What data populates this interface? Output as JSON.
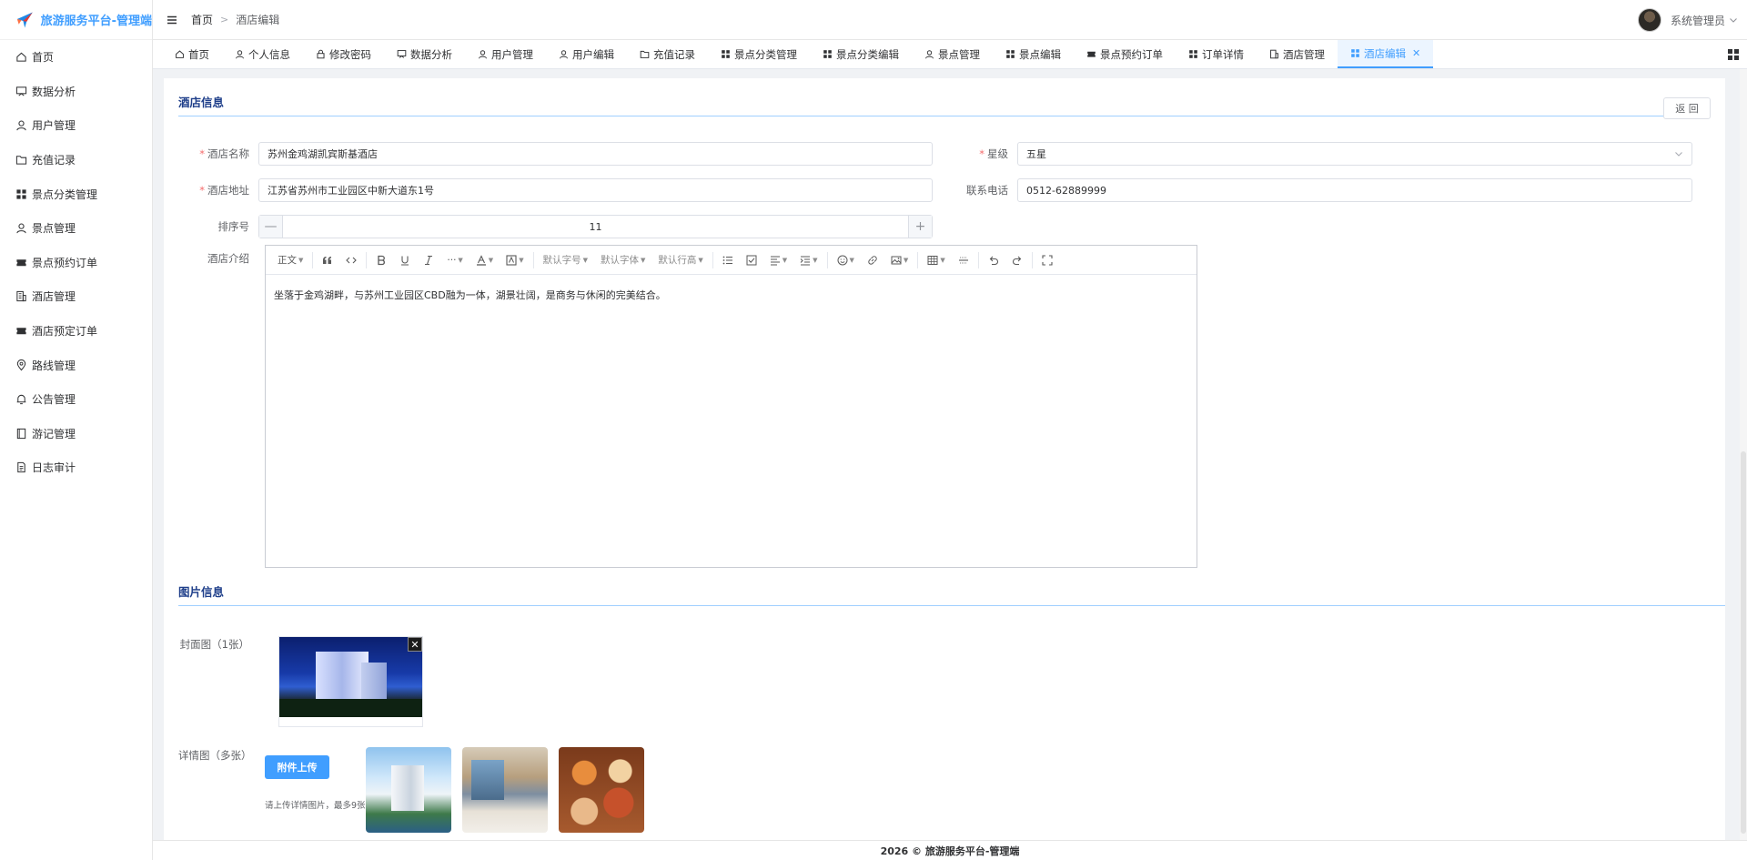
{
  "app": {
    "title": "旅游服务平台-管理端"
  },
  "sidebar": {
    "items": [
      {
        "label": "首页",
        "icon": "home-icon"
      },
      {
        "label": "数据分析",
        "icon": "chart-board-icon"
      },
      {
        "label": "用户管理",
        "icon": "user-icon"
      },
      {
        "label": "充值记录",
        "icon": "folder-icon"
      },
      {
        "label": "景点分类管理",
        "icon": "grid-icon"
      },
      {
        "label": "景点管理",
        "icon": "user-icon"
      },
      {
        "label": "景点预约订单",
        "icon": "ticket-icon"
      },
      {
        "label": "酒店管理",
        "icon": "building-icon"
      },
      {
        "label": "酒店预定订单",
        "icon": "ticket-icon"
      },
      {
        "label": "路线管理",
        "icon": "location-icon"
      },
      {
        "label": "公告管理",
        "icon": "bell-icon"
      },
      {
        "label": "游记管理",
        "icon": "notebook-icon"
      },
      {
        "label": "日志审计",
        "icon": "document-icon"
      }
    ]
  },
  "header": {
    "breadcrumb": [
      "首页",
      "酒店编辑"
    ],
    "user_name": "系统管理员"
  },
  "tabs": [
    {
      "label": "首页",
      "icon": "home-icon"
    },
    {
      "label": "个人信息",
      "icon": "user-icon"
    },
    {
      "label": "修改密码",
      "icon": "lock-icon"
    },
    {
      "label": "数据分析",
      "icon": "chart-board-icon"
    },
    {
      "label": "用户管理",
      "icon": "user-icon"
    },
    {
      "label": "用户编辑",
      "icon": "user-icon"
    },
    {
      "label": "充值记录",
      "icon": "folder-icon"
    },
    {
      "label": "景点分类管理",
      "icon": "grid-icon"
    },
    {
      "label": "景点分类编辑",
      "icon": "grid-icon"
    },
    {
      "label": "景点管理",
      "icon": "user-icon"
    },
    {
      "label": "景点编辑",
      "icon": "grid-icon"
    },
    {
      "label": "景点预约订单",
      "icon": "ticket-icon"
    },
    {
      "label": "订单详情",
      "icon": "grid-icon"
    },
    {
      "label": "酒店管理",
      "icon": "building-icon"
    },
    {
      "label": "酒店编辑",
      "icon": "grid-icon",
      "active": true
    }
  ],
  "hotel_section": {
    "title": "酒店信息",
    "back_label": "返 回",
    "name_label": "酒店名称",
    "name_value": "苏州金鸡湖凯宾斯基酒店",
    "star_label": "星级",
    "star_value": "五星",
    "address_label": "酒店地址",
    "address_value": "江苏省苏州市工业园区中新大道东1号",
    "phone_label": "联系电话",
    "phone_value": "0512-62889999",
    "sort_label": "排序号",
    "sort_value": "11",
    "intro_label": "酒店介绍",
    "intro_text": "坐落于金鸡湖畔，与苏州工业园区CBD融为一体，湖景壮阔，是商务与休闲的完美结合。"
  },
  "editor_toolbar": {
    "paragraph": "正文",
    "font_size": "默认字号",
    "font_family": "默认字体",
    "line_height": "默认行高"
  },
  "image_section": {
    "title": "图片信息",
    "cover_label": "封面图（1张）",
    "detail_label": "详情图（多张）",
    "upload_label": "附件上传",
    "upload_tip": "请上传详情图片，最多9张"
  },
  "footer": {
    "text": "2026 © 旅游服务平台-管理端"
  },
  "colors": {
    "primary": "#409eff",
    "section_title": "#1f3f8a",
    "required": "#f56c6c"
  }
}
